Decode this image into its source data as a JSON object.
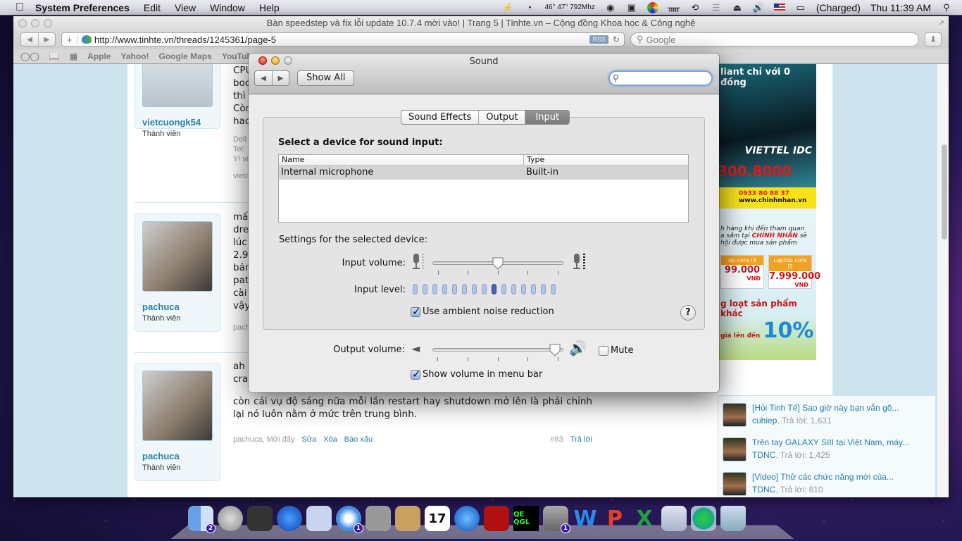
{
  "menubar": {
    "app_name": "System Preferences",
    "menus": [
      "Edit",
      "View",
      "Window",
      "Help"
    ],
    "status": {
      "cpu_readout": "46° 47° 792Mhz",
      "battery_text": "(Charged)",
      "clock": "Thu 11:39 AM"
    }
  },
  "safari": {
    "window_title": "Bàn speedstep và fix lỗi update 10.7.4 mời vào! | Trang 5 | Tinhte.vn – Cộng đồng Khoa học & Công nghệ",
    "url": "http://www.tinhte.vn/threads/1245361/page-5",
    "rss_label": "RSS",
    "search_placeholder": "Google",
    "bookmarks": [
      "Apple",
      "Yahoo!",
      "Google Maps",
      "YouTube"
    ]
  },
  "page": {
    "posts": [
      {
        "username": "vietcuongk54",
        "role": "Thành viên",
        "lines": [
          "CPU",
          "boo",
          "thì",
          "Còn",
          "hac"
        ],
        "sig": [
          "Dell",
          "Tel:",
          "Y! vi"
        ],
        "meta": "vietc"
      },
      {
        "username": "pachuca",
        "role": "Thành viên",
        "lines": [
          "mấ",
          "dre",
          "lúc",
          "2.9",
          "bản",
          "pat",
          "cài",
          "vậy"
        ],
        "meta": "pach"
      },
      {
        "username": "pachuca",
        "role": "Thành viên",
        "lines": [
          "ah",
          "cra"
        ],
        "body": "còn cái vụ độ sáng nữa mỗi lần restart hay shutdown mở lên là phải chỉnh lại nó luôn nằm ở mức trên trung bình.",
        "meta_author": "pachuca, Mới đây",
        "actions": [
          "Sửa",
          "Xóa",
          "Báo xấu"
        ],
        "post_number": "#83",
        "reply": "Trả lời"
      }
    ],
    "ad": {
      "headline": "liant chỉ với 0 đồng",
      "brand": "VIETTEL IDC",
      "phone_big": "300.8000",
      "phone": "0933 80 88 37",
      "site": "www.chinhnhan.vn",
      "body_line1": "h hàng khi đến tham quan",
      "body_line2_pre": "a sắm tại ",
      "body_line2_hl": "CHÍNH NHÂN",
      "body_line2_post": " sẽ",
      "body_line3": "hội được mua sản phẩm",
      "prices": [
        {
          "label": "op core i3",
          "value": "99.000",
          "unit": "VNĐ"
        },
        {
          "label": "Laptop core i5",
          "value": "7.999.000",
          "unit": "VNĐ"
        }
      ],
      "promo": "g loạt sản phẩm khác",
      "promo2": "giá lên đến",
      "pct": "10%"
    },
    "threads": [
      {
        "title": "[Hỏi Tinh Tế] Sao giờ này bạn vẫn gõ...",
        "author": "cuhiep",
        "replies": ", Trả lời: 1,631"
      },
      {
        "title": "Trên tay GALAXY SIII tại Việt Nam, máy...",
        "author": "TDNC",
        "replies": ", Trả lời: 1,425"
      },
      {
        "title": "[Video] Thử các chức năng mới của...",
        "author": "TDNC",
        "replies": ", Trả lời: 810"
      }
    ]
  },
  "sound": {
    "window_title": "Sound",
    "show_all": "Show All",
    "search_value": "",
    "tabs": [
      "Sound Effects",
      "Output",
      "Input"
    ],
    "selected_tab": "Input",
    "device_heading": "Select a device for sound input:",
    "columns": [
      "Name",
      "Type"
    ],
    "devices": [
      {
        "name": "Internal microphone",
        "type": "Built-in",
        "selected": true
      }
    ],
    "settings_heading": "Settings for the selected device:",
    "input_volume_label": "Input volume:",
    "input_volume": 0.5,
    "input_level_label": "Input level:",
    "input_level_segments": 15,
    "input_level_active": 9,
    "ambient_noise_label": "Use ambient noise reduction",
    "ambient_noise_checked": true,
    "help_label": "?",
    "output_volume_label": "Output volume:",
    "output_volume": 1.0,
    "mute_label": "Mute",
    "mute_checked": false,
    "show_volume_label": "Show volume in menu bar",
    "show_volume_checked": true
  },
  "dock": {
    "items": [
      {
        "name": "Finder",
        "badge": "2"
      },
      {
        "name": "Launchpad"
      },
      {
        "name": "Mission Control"
      },
      {
        "name": "App Store"
      },
      {
        "name": "Mail"
      },
      {
        "name": "Safari",
        "badge": "1"
      },
      {
        "name": "FaceTime"
      },
      {
        "name": "Address Book"
      },
      {
        "name": "iCal",
        "text": "17"
      },
      {
        "name": "iTunes"
      },
      {
        "name": "Photo Booth"
      },
      {
        "name": "Quartz Debug",
        "text": "QE QGL"
      },
      {
        "name": "System Preferences",
        "badge": "1"
      },
      {
        "name": "Word",
        "text": "W"
      },
      {
        "name": "PowerPoint",
        "text": "P"
      },
      {
        "name": "Excel",
        "text": "X"
      },
      {
        "name": "Documents"
      },
      {
        "name": "Downloads"
      },
      {
        "name": "Trash"
      }
    ]
  }
}
